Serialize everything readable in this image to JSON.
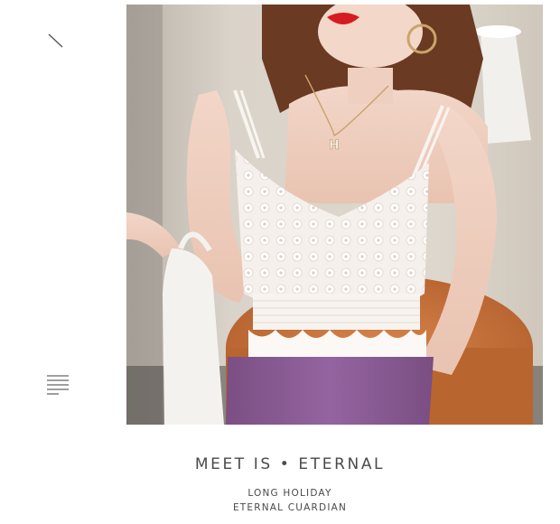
{
  "icons": {
    "slash": "slash-icon",
    "menu": "menu-lines-icon"
  },
  "photo": {
    "subject": "model-wearing-top",
    "letter": "H"
  },
  "caption": {
    "title": "MEET IS • ETERNAL",
    "line1": "LONG HOLIDAY",
    "line2": "ETERNAL CUARDIAN"
  },
  "colors": {
    "text": "#4a4a4a",
    "skirt": "#8a5a8f",
    "stool": "#c8713a",
    "top": "#f6f2ee"
  }
}
